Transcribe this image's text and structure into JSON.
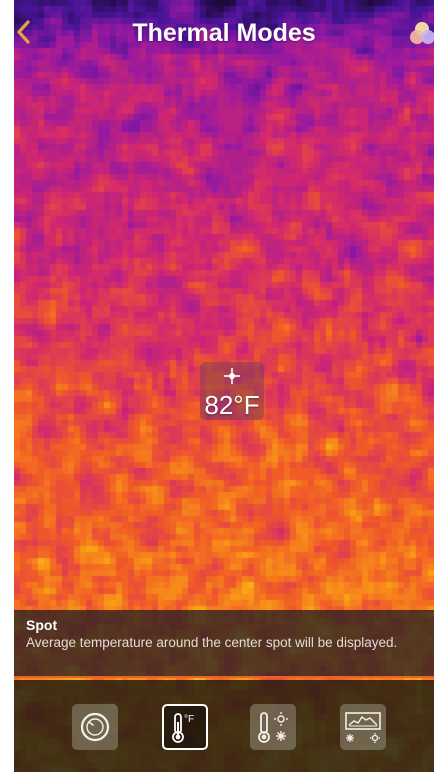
{
  "header": {
    "title": "Thermal Modes",
    "back_icon": "chevron-left-icon",
    "palette_icon": "color-palette-icon"
  },
  "reading": {
    "temperature": "82°F"
  },
  "mode_info": {
    "title": "Spot",
    "description": "Average temperature around the center spot will be displayed."
  },
  "modes": [
    {
      "icon": "dial-icon",
      "active": false
    },
    {
      "icon": "spot-thermometer-fahrenheit-icon",
      "active": true,
      "unit_label": "°F"
    },
    {
      "icon": "hot-cold-thermometer-icon",
      "active": false
    },
    {
      "icon": "range-graph-icon",
      "active": false
    }
  ],
  "colors": {
    "accent": "#e8622a",
    "back_chevron": "#e8a23a",
    "text": "#ffffff"
  }
}
